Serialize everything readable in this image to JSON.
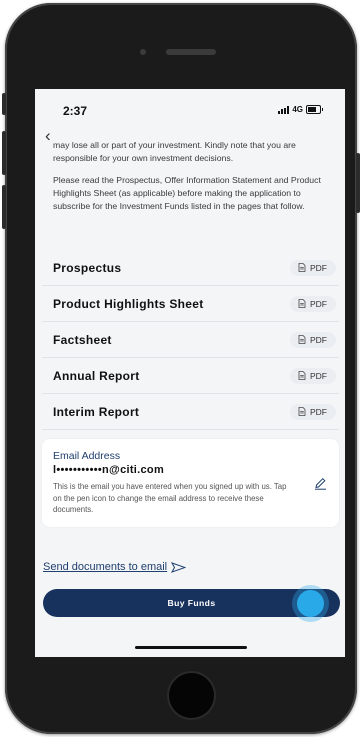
{
  "status_bar": {
    "time": "2:37",
    "network": "4G"
  },
  "disclaimer": {
    "paragraph1": "may lose all or part of your investment. Kindly note that you are responsible for your own investment decisions.",
    "paragraph2": "Please read the Prospectus, Offer Information Statement and Product Highlights Sheet (as applicable) before making the application to subscribe for the Investment Funds listed in the pages that follow."
  },
  "documents": [
    {
      "name": "Prospectus",
      "button": "PDF"
    },
    {
      "name": "Product Highlights Sheet",
      "button": "PDF"
    },
    {
      "name": "Factsheet",
      "button": "PDF"
    },
    {
      "name": "Annual Report",
      "button": "PDF"
    },
    {
      "name": "Interim Report",
      "button": "PDF"
    }
  ],
  "email": {
    "title": "Email Address",
    "value": "l•••••••••••n@citi.com",
    "description": "This is the email you have entered when you signed up with us. Tap on the pen icon to change the email address to receive these documents."
  },
  "send_link": "Send documents to email",
  "buy_button": "Buy Funds",
  "icons": {
    "back": "chevron-left-icon",
    "pdf": "document-icon",
    "edit": "pen-icon",
    "send": "paper-plane-icon"
  },
  "colors": {
    "accent": "#18325e",
    "link": "#1f3f6e",
    "touch": "#2aa9e8"
  }
}
